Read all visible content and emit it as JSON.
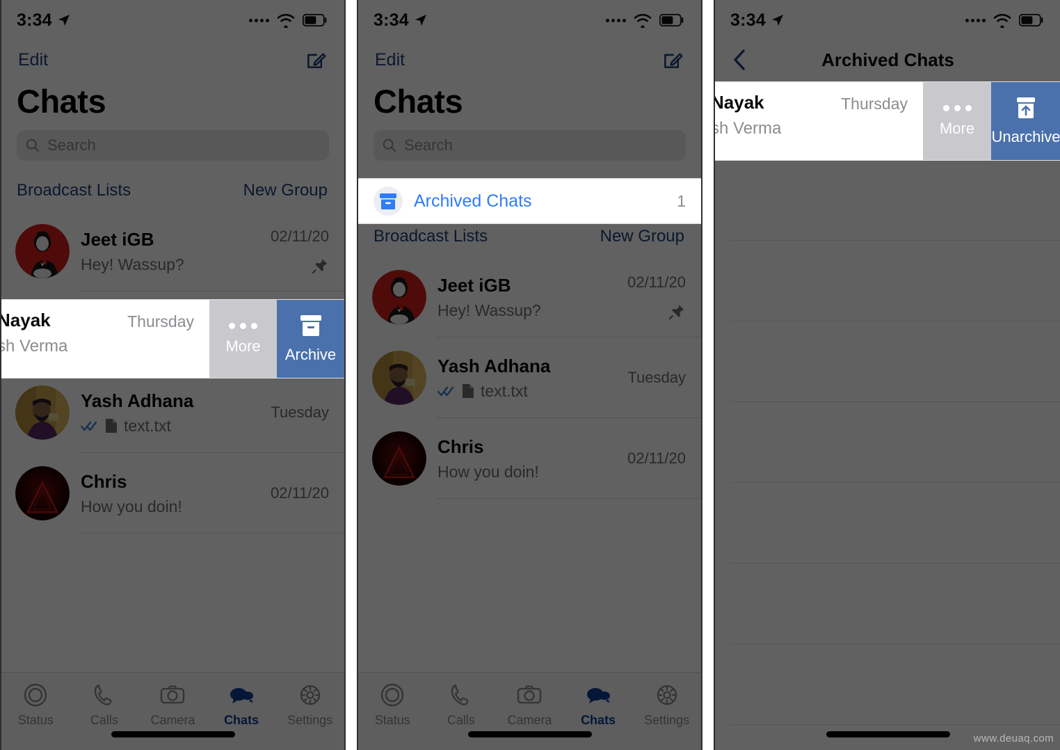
{
  "meta": {
    "watermark": "www.deuaq.com"
  },
  "status_bar": {
    "time": "3:34",
    "location_icon": "location-arrow-icon",
    "signal_icon": "signal-dots-icon",
    "wifi_icon": "wifi-icon",
    "battery_icon": "battery-icon"
  },
  "colors": {
    "ios_blue": "#2f7cf6",
    "nav_blue": "#1f3f7a",
    "archive_blue": "#4a71ab",
    "more_gray": "#c9c8cd",
    "tab_active": "#0b3d91"
  },
  "panel1": {
    "nav": {
      "edit_label": "Edit",
      "compose_icon": "compose-icon"
    },
    "title": "Chats",
    "search": {
      "placeholder": "Search",
      "icon": "search-icon"
    },
    "broadcast": {
      "left_label": "Broadcast Lists",
      "right_label": "New Group"
    },
    "chats": [
      {
        "name": "Jeet iGB",
        "message": "Hey! Wassup?",
        "time": "02/11/20",
        "pinned": true,
        "avatar": "avatar-jeet"
      },
      {
        "name": "Yash Adhana",
        "message": "text.txt",
        "time": "Tuesday",
        "read_receipt": "double-check-icon",
        "attachment_icon": "document-icon",
        "avatar": "avatar-yash"
      },
      {
        "name": "Chris",
        "message": "How you doin!",
        "time": "02/11/20",
        "avatar": "avatar-chris"
      }
    ],
    "swipe_row": {
      "name_clipped": "Nayak",
      "subtitle_clipped": "sh Verma",
      "day": "Thursday",
      "more_label": "More",
      "more_icon": "ellipsis-icon",
      "action_label": "Archive",
      "action_icon": "archive-box-icon"
    },
    "tabs": [
      {
        "label": "Status",
        "icon": "status-rings-icon",
        "active": false
      },
      {
        "label": "Calls",
        "icon": "phone-icon",
        "active": false
      },
      {
        "label": "Camera",
        "icon": "camera-icon",
        "active": false
      },
      {
        "label": "Chats",
        "icon": "chat-bubbles-icon",
        "active": true
      },
      {
        "label": "Settings",
        "icon": "gear-icon",
        "active": false
      }
    ]
  },
  "panel2": {
    "nav": {
      "edit_label": "Edit",
      "compose_icon": "compose-icon"
    },
    "title": "Chats",
    "search": {
      "placeholder": "Search",
      "icon": "search-icon"
    },
    "archived": {
      "label": "Archived Chats",
      "count": "1",
      "icon": "archive-box-icon"
    },
    "broadcast": {
      "left_label": "Broadcast Lists",
      "right_label": "New Group"
    },
    "chats": [
      {
        "name": "Jeet iGB",
        "message": "Hey! Wassup?",
        "time": "02/11/20",
        "pinned": true,
        "avatar": "avatar-jeet"
      },
      {
        "name": "Yash Adhana",
        "message": "text.txt",
        "time": "Tuesday",
        "read_receipt": "double-check-icon",
        "attachment_icon": "document-icon",
        "avatar": "avatar-yash"
      },
      {
        "name": "Chris",
        "message": "How you doin!",
        "time": "02/11/20",
        "avatar": "avatar-chris"
      }
    ],
    "tabs": [
      {
        "label": "Status",
        "icon": "status-rings-icon",
        "active": false
      },
      {
        "label": "Calls",
        "icon": "phone-icon",
        "active": false
      },
      {
        "label": "Camera",
        "icon": "camera-icon",
        "active": false
      },
      {
        "label": "Chats",
        "icon": "chat-bubbles-icon",
        "active": true
      },
      {
        "label": "Settings",
        "icon": "gear-icon",
        "active": false
      }
    ]
  },
  "panel3": {
    "nav": {
      "back_icon": "back-chevron-icon",
      "title": "Archived Chats"
    },
    "swipe_row": {
      "name_clipped": "Nayak",
      "subtitle_clipped": "sh Verma",
      "day": "Thursday",
      "more_label": "More",
      "more_icon": "ellipsis-icon",
      "action_label": "Unarchive",
      "action_icon": "unarchive-box-icon"
    }
  }
}
